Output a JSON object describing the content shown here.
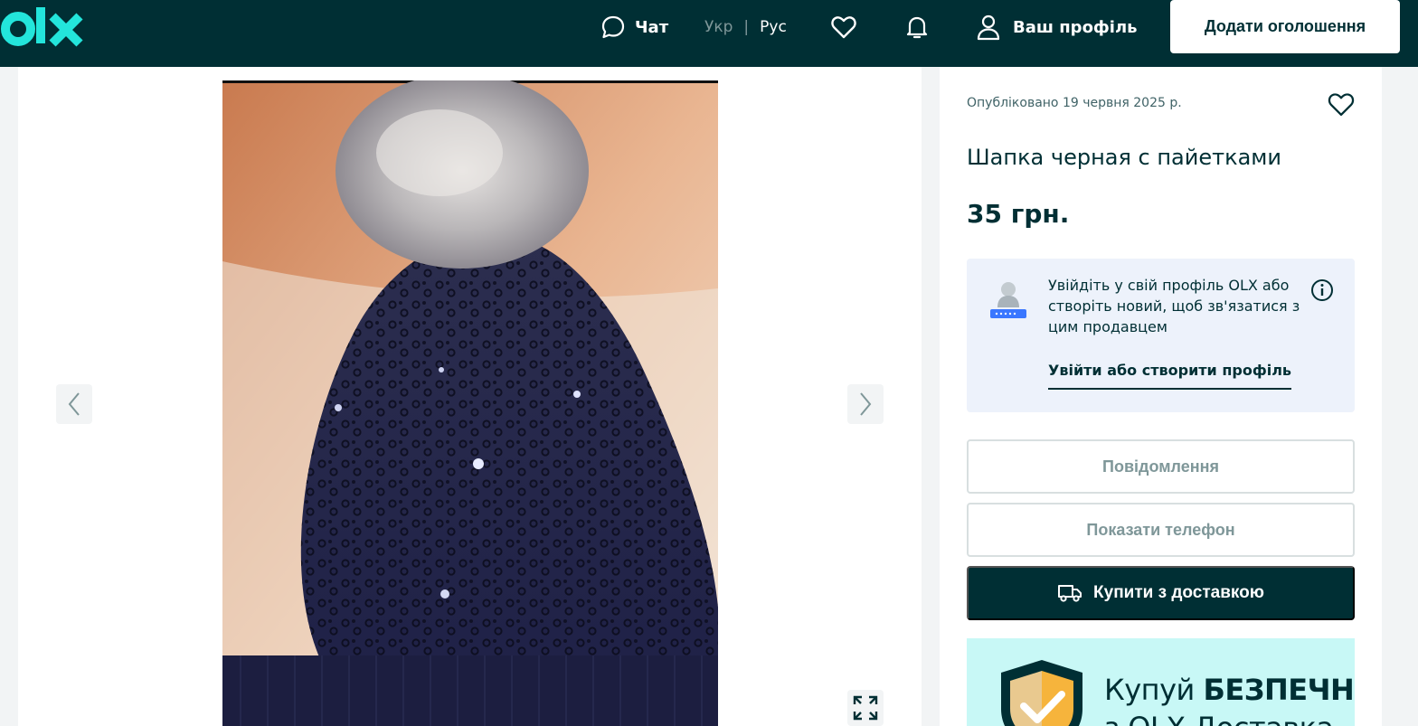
{
  "header": {
    "logo_text": "olx",
    "chat_label": "Чат",
    "lang_uk": "Укр",
    "lang_sep": "|",
    "lang_ru": "Рус",
    "profile_label": "Ваш профіль",
    "post_ad_label": "Додати оголошення"
  },
  "ad": {
    "posted": "Опубліковано 19 червня 2025 р.",
    "title": "Шапка черная с пайетками",
    "price": "35 грн."
  },
  "login_box": {
    "text": "Увійдіть у свій профіль OLX або створіть новий, щоб зв'язатися з цим продавцем",
    "link": "Увійти або створити профіль"
  },
  "buttons": {
    "message": "Повідомлення",
    "show_phone": "Показати телефон",
    "buy_delivery": "Купити з доставкою"
  },
  "promo": {
    "line1_regular": "Купуй ",
    "line1_bold": "БЕЗПЕЧНО",
    "line2": "з OLX Доставка"
  },
  "colors": {
    "brand_dark": "#002f34",
    "logo_teal": "#23e5db",
    "promo_bg": "#c8f8f6",
    "login_bg": "#edf2fb"
  },
  "icons": {
    "chat": "chat-bubble-icon",
    "favorites": "heart-icon",
    "notifications": "bell-icon",
    "profile": "user-icon",
    "prev": "chevron-left-icon",
    "next": "chevron-right-icon",
    "fullscreen": "expand-icon",
    "info": "info-icon",
    "delivery": "truck-icon"
  }
}
